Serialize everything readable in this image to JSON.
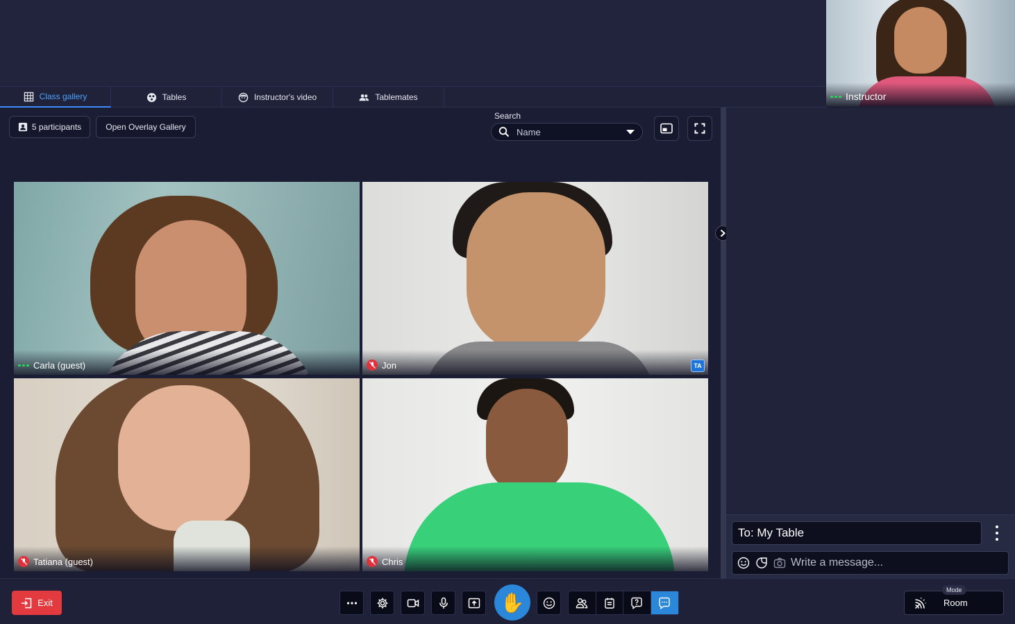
{
  "tabs": [
    {
      "label": "Class gallery",
      "icon": "grid-icon",
      "active": true
    },
    {
      "label": "Tables",
      "icon": "table-icon",
      "active": false
    },
    {
      "label": "Instructor's video",
      "icon": "face-icon",
      "active": false
    },
    {
      "label": "Tablemates",
      "icon": "people-icon",
      "active": false
    }
  ],
  "instructor": {
    "name": "Instructor"
  },
  "toolbar": {
    "participants_label": "5 participants",
    "overlay_label": "Open Overlay Gallery",
    "search_label": "Search",
    "search_value": "Name"
  },
  "tiles": [
    {
      "name": "Carla (guest)",
      "muted": false
    },
    {
      "name": "Jon",
      "muted": true,
      "badge": "TA"
    },
    {
      "name": "Tatiana (guest)",
      "muted": true
    },
    {
      "name": "Chris",
      "muted": true
    }
  ],
  "chat": {
    "recipient": "To: My Table",
    "placeholder": "Write a message..."
  },
  "bottom": {
    "exit_label": "Exit",
    "mode_label": "Mode",
    "mode_value": "Room"
  },
  "colors": {
    "accent": "#2b87d9",
    "danger": "#e23a3f",
    "background": "#1d1f36",
    "speaking": "#2ed158"
  }
}
